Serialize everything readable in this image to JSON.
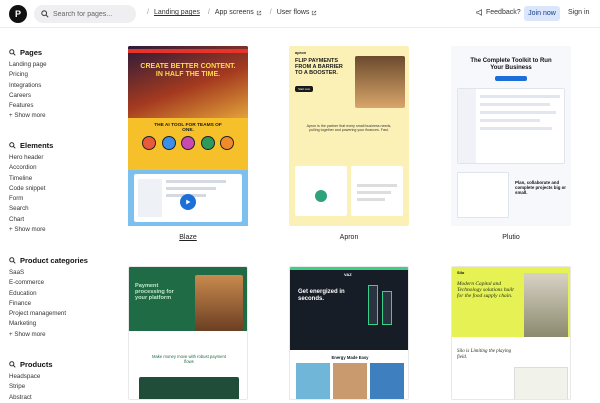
{
  "header": {
    "logo_letter": "P",
    "search_placeholder": "Search for pages...",
    "breadcrumbs": [
      {
        "label": "Landing pages",
        "active": true
      },
      {
        "label": "App screens",
        "external": true
      },
      {
        "label": "User flows",
        "external": true
      }
    ],
    "feedback_label": "Feedback?",
    "join_label": "Join now",
    "signin_label": "Sign in"
  },
  "sidebar": {
    "pages": {
      "title": "Pages",
      "items": [
        "Landing page",
        "Pricing",
        "Integrations",
        "Careers",
        "Features"
      ],
      "more": "+ Show more"
    },
    "elements": {
      "title": "Elements",
      "items": [
        "Hero header",
        "Accordion",
        "Timeline",
        "Code snippet",
        "Form",
        "Search",
        "Chart"
      ],
      "more": "+ Show more"
    },
    "product_categories": {
      "title": "Product categories",
      "items": [
        "SaaS",
        "E-commerce",
        "Education",
        "Finance",
        "Project management",
        "Marketing"
      ],
      "more": "+ Show more"
    },
    "products": {
      "title": "Products",
      "items": [
        "Headspace",
        "Stripe",
        "Abstract"
      ]
    }
  },
  "cards": [
    {
      "name": "Blaze",
      "headline": "CREATE BETTER CONTENT. IN HALF THE TIME.",
      "sub": "THE AI TOOL FOR TEAMS OF ONE."
    },
    {
      "name": "Apron",
      "brand": "apron",
      "headline": "FLIP PAYMENTS FROM A BARRIER TO A BOOSTER.",
      "cta": "Start now",
      "body": "Apron is the partner that every small business needs, pulling together and powering your finances. Fast."
    },
    {
      "name": "Plutio",
      "headline": "The Complete Toolkit to Run Your Business",
      "sub": "Plan, collaborate and complete projects big or small."
    },
    {
      "headline": "Payment processing for your platform",
      "sub": "Make money move with robust payment flows"
    },
    {
      "brand": "VAZ",
      "headline": "Get energized in seconds.",
      "sub": "Energy Made Easy"
    },
    {
      "brand": "Silo",
      "headline": "Modern Capital and Technology solutions built for the food supply chain.",
      "sub": "Silo is Limiting the playing field."
    }
  ],
  "colors": {
    "join_bg": "#d9e6fb",
    "blaze_bg": "#101418",
    "apron_bg": "#fbf1b6",
    "plutio_bg": "#f6f8fc",
    "fin_green": "#1f6b45",
    "vaz_dark": "#171d26",
    "silo_lime": "#e6f253"
  }
}
